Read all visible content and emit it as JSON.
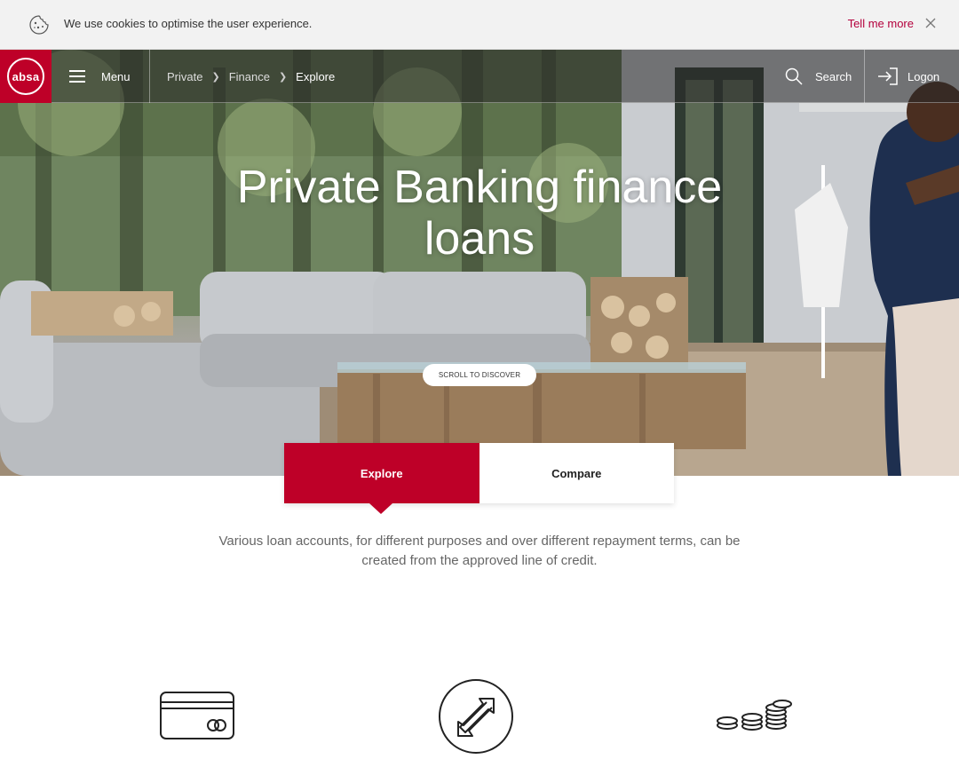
{
  "cookie_bar": {
    "message": "We use cookies to optimise the user experience.",
    "more_link": "Tell me more"
  },
  "navbar": {
    "logo_text": "absa",
    "menu_label": "Menu",
    "breadcrumb": [
      "Private",
      "Finance",
      "Explore"
    ],
    "search_label": "Search",
    "logon_label": "Logon"
  },
  "hero": {
    "title": "Private Banking finance loans",
    "scroll_label": "SCROLL TO DISCOVER"
  },
  "tabs": [
    {
      "label": "Explore",
      "active": true
    },
    {
      "label": "Compare",
      "active": false
    }
  ],
  "intro_text": "Various loan accounts, for different purposes and over different repayment terms, can be created from the approved line of credit.",
  "features": [
    {
      "icon": "credit-card-icon"
    },
    {
      "icon": "transfer-arrows-icon"
    },
    {
      "icon": "coins-stack-icon"
    }
  ],
  "colors": {
    "brand": "#be0028",
    "link": "#b4003c"
  }
}
